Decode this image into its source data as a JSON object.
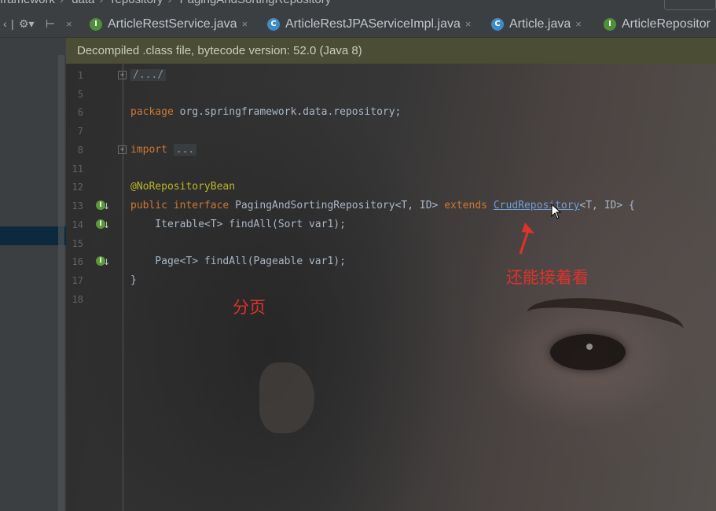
{
  "breadcrumb": {
    "items": [
      "framework",
      "data",
      "repository",
      "PagingAndSortingRepository"
    ]
  },
  "toolbar": {
    "left_icons": [
      "collapse-arrows-icon",
      "settings-gear-icon",
      "hide-panel-icon"
    ]
  },
  "tabs": [
    {
      "label": "ArticleRestService.java",
      "kind": "I",
      "icon": "interface-icon"
    },
    {
      "label": "ArticleRestJPAServiceImpl.java",
      "kind": "C",
      "icon": "class-icon"
    },
    {
      "label": "Article.java",
      "kind": "C",
      "icon": "class-icon"
    },
    {
      "label": "ArticleRepositor",
      "kind": "I",
      "icon": "interface-icon"
    }
  ],
  "banner": {
    "text": "Decompiled .class file, bytecode version: 52.0 (Java 8)"
  },
  "editor": {
    "lines": [
      {
        "num": "1",
        "folded": "/.../"
      },
      {
        "num": "5"
      },
      {
        "num": "6",
        "kw": "package",
        "rest": " org.springframework.data.repository;"
      },
      {
        "num": "7"
      },
      {
        "num": "8",
        "kw": "import",
        "folded": "..."
      },
      {
        "num": "11"
      },
      {
        "num": "12",
        "annotation": "@NoRepositoryBean"
      },
      {
        "num": "13",
        "public": "public",
        "interface_kw": "interface",
        "name": "PagingAndSortingRepository",
        "generic": "<T, ID>",
        "extends_kw": "extends",
        "parent": "CrudRepository",
        "tail": "<T, ID> {"
      },
      {
        "num": "14",
        "text": "    Iterable<T> findAll(Sort var1);"
      },
      {
        "num": "15"
      },
      {
        "num": "16",
        "text": "    Page<T> findAll(Pageable var1);"
      },
      {
        "num": "17",
        "text": "}"
      },
      {
        "num": "18"
      }
    ]
  },
  "notes": {
    "paging": "分页",
    "continue_reading": "还能接着看"
  },
  "colors": {
    "keyword": "#cc7832",
    "annotation": "#bbb529",
    "link": "#6f9fd8",
    "note_red": "#e0322b"
  }
}
